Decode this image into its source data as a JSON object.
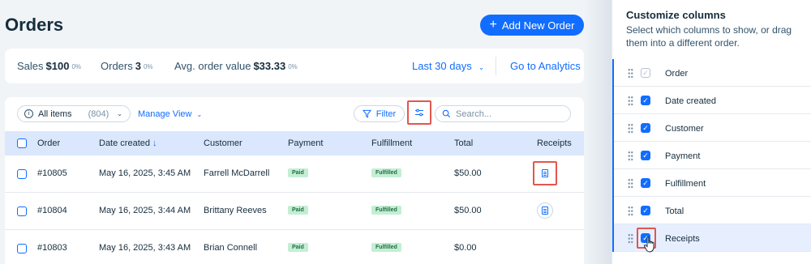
{
  "page": {
    "title": "Orders",
    "add_button": "Add New Order"
  },
  "stats": {
    "sales_label": "Sales",
    "sales_value": "$100",
    "sales_pct": "0%",
    "orders_label": "Orders",
    "orders_value": "3",
    "orders_pct": "0%",
    "aov_label": "Avg. order value",
    "aov_value": "$33.33",
    "aov_pct": "0%",
    "period": "Last 30 days",
    "analytics_link": "Go to Analytics"
  },
  "toolbar": {
    "view_label": "All items",
    "view_count": "(804)",
    "manage_view": "Manage View",
    "filter": "Filter",
    "search_placeholder": "Search..."
  },
  "table": {
    "headers": {
      "order": "Order",
      "date": "Date created",
      "customer": "Customer",
      "payment": "Payment",
      "fulfillment": "Fulfillment",
      "total": "Total",
      "receipts": "Receipts"
    },
    "rows": [
      {
        "order": "#10805",
        "date": "May 16, 2025, 3:45 AM",
        "customer": "Farrell McDarrell",
        "payment": "Paid",
        "fulfillment": "Fulfilled",
        "total": "$50.00"
      },
      {
        "order": "#10804",
        "date": "May 16, 2025, 3:44 AM",
        "customer": "Brittany Reeves",
        "payment": "Paid",
        "fulfillment": "Fulfilled",
        "total": "$50.00"
      },
      {
        "order": "#10803",
        "date": "May 16, 2025, 3:43 AM",
        "customer": "Brian Connell",
        "payment": "Paid",
        "fulfillment": "Fulfilled",
        "total": "$0.00"
      }
    ]
  },
  "panel": {
    "title": "Customize columns",
    "subtitle": "Select which columns to show, or drag them into a different order.",
    "columns": [
      {
        "label": "Order",
        "checked": true,
        "disabled": true
      },
      {
        "label": "Date created",
        "checked": true
      },
      {
        "label": "Customer",
        "checked": true
      },
      {
        "label": "Payment",
        "checked": true
      },
      {
        "label": "Fulfillment",
        "checked": true
      },
      {
        "label": "Total",
        "checked": true
      },
      {
        "label": "Receipts",
        "checked": true
      }
    ]
  },
  "colors": {
    "accent": "#116dff",
    "highlight": "#e2564f",
    "header_bg": "#dae7fc",
    "badge_bg": "#c4eed4"
  },
  "icons": {
    "add": "plus-icon",
    "filter": "funnel-icon",
    "customize": "sliders-icon",
    "search": "search-icon",
    "receipt": "receipt-icon",
    "drag": "drag-handle-icon"
  }
}
